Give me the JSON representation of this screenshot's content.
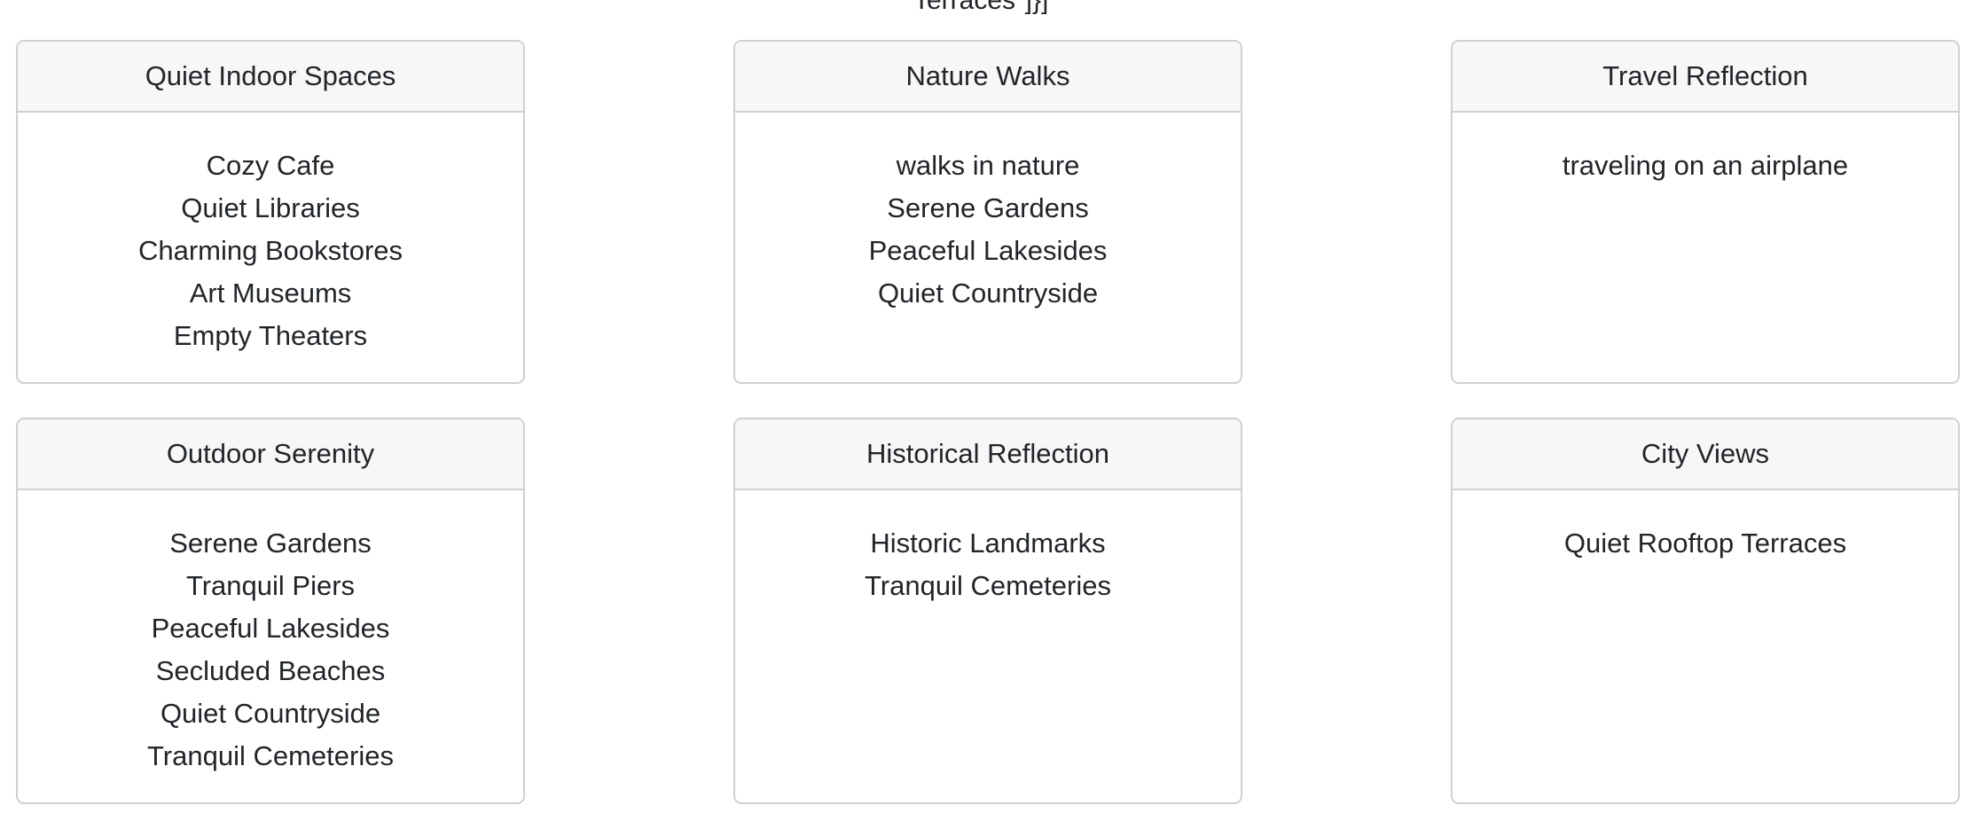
{
  "top_fragment": "Terraces\"]}]",
  "cards": [
    {
      "title": "Quiet Indoor Spaces",
      "items": [
        "Cozy Cafe",
        "Quiet Libraries",
        "Charming Bookstores",
        "Art Museums",
        "Empty Theaters"
      ]
    },
    {
      "title": "Nature Walks",
      "items": [
        "walks in nature",
        "Serene Gardens",
        "Peaceful Lakesides",
        "Quiet Countryside"
      ]
    },
    {
      "title": "Travel Reflection",
      "items": [
        "traveling on an airplane"
      ]
    },
    {
      "title": "Outdoor Serenity",
      "items": [
        "Serene Gardens",
        "Tranquil Piers",
        "Peaceful Lakesides",
        "Secluded Beaches",
        "Quiet Countryside",
        "Tranquil Cemeteries"
      ]
    },
    {
      "title": "Historical Reflection",
      "items": [
        "Historic Landmarks",
        "Tranquil Cemeteries"
      ]
    },
    {
      "title": "City Views",
      "items": [
        "Quiet Rooftop Terraces"
      ]
    }
  ]
}
